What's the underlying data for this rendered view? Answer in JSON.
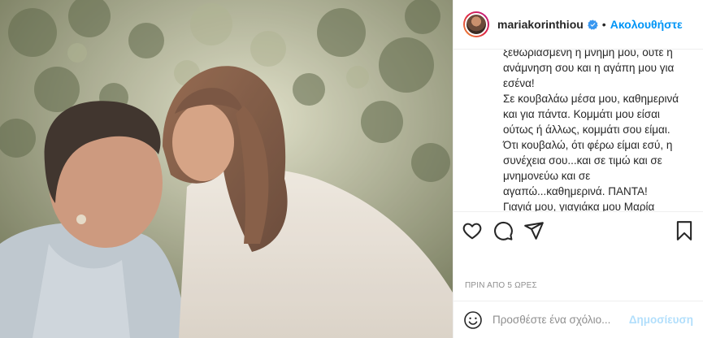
{
  "post": {
    "photo_alt": "",
    "photo_icon": "photo"
  },
  "header": {
    "username": "mariakorinthiou",
    "verified_icon": "verified-badge-icon",
    "separator": "•",
    "follow_label": "Ακολουθήστε"
  },
  "caption": {
    "lines": [
      "ξεθωριασμένη η μνήμη μου, ούτε η",
      "ανάμνηση σου και η αγάπη μου για",
      "εσένα!",
      "Σε κουβαλάω μέσα μου, καθημερινά",
      "και για πάντα. Κομμάτι μου είσαι",
      "ούτως ή άλλως, κομμάτι σου είμαι.",
      "Ότι κουβαλώ, ότι φέρω είμαι εσύ, η",
      "συνέχεια σου...και σε τιμώ και σε",
      "μνημονεύω και σε",
      "αγαπώ...καθημερινά. ΠΑΝΤΑ!",
      "Γιαγιά μου, γιαγιάκα μου Μαρία"
    ]
  },
  "actions": {
    "like_icon": "heart-icon",
    "comment_icon": "comment-icon",
    "share_icon": "share-icon",
    "save_icon": "bookmark-icon"
  },
  "timestamp": "ΠΡΙΝ ΑΠΟ 5 ΩΡΕΣ",
  "comment_box": {
    "emoji_icon": "emoji-icon",
    "placeholder": "Προσθέστε ένα σχόλιο...",
    "post_label": "Δημοσίευση"
  },
  "colors": {
    "accent": "#0095f6",
    "post_disabled": "#b2dffc",
    "muted": "#8e8e8e",
    "border": "#efefef"
  }
}
